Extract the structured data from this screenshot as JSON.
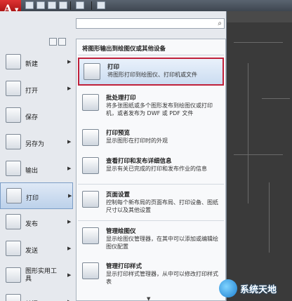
{
  "app": {
    "logo_letter": "A"
  },
  "search": {
    "placeholder": ""
  },
  "left_menu": [
    {
      "label": "新建",
      "icon": "new-file-icon",
      "has_arrow": true
    },
    {
      "label": "打开",
      "icon": "open-folder-icon",
      "has_arrow": true
    },
    {
      "label": "保存",
      "icon": "save-disk-icon",
      "has_arrow": false
    },
    {
      "label": "另存为",
      "icon": "save-as-icon",
      "has_arrow": true
    },
    {
      "label": "输出",
      "icon": "export-icon",
      "has_arrow": true
    },
    {
      "label": "打印",
      "icon": "printer-icon",
      "has_arrow": true,
      "active": true
    },
    {
      "label": "发布",
      "icon": "publish-icon",
      "has_arrow": true
    },
    {
      "label": "发送",
      "icon": "send-icon",
      "has_arrow": true
    },
    {
      "label": "图形实用工具",
      "icon": "drawing-utilities-icon",
      "has_arrow": true,
      "two_line": [
        "图形实用工",
        "具"
      ]
    },
    {
      "label": "关闭",
      "icon": "close-folder-icon",
      "has_arrow": true
    }
  ],
  "submenu": {
    "title": "将图形输出到绘图仪或其他设备",
    "items": [
      {
        "title": "打印",
        "desc": "将图形打印到绘图仪、打印机或文件",
        "icon": "printer-icon",
        "highlighted": true
      },
      {
        "title": "批处理打印",
        "desc": "将多张图纸或多个图形发布到绘图仪或打印机，或者发布为 DWF 或 PDF 文件",
        "icon": "batch-plot-icon"
      },
      {
        "title": "打印预览",
        "desc": "显示图形在打印时的外观",
        "icon": "preview-icon"
      },
      {
        "title": "查看打印和发布详细信息",
        "desc": "显示有关已完成的打印和发布作业的信息",
        "icon": "plot-details-icon"
      },
      {
        "title": "页面设置",
        "desc": "控制每个新布局的页面布局、打印设备、图纸尺寸以及其他设置",
        "icon": "page-setup-icon"
      },
      {
        "title": "管理绘图仪",
        "desc": "显示绘图仪管理器，在其中可以添加或编辑绘图仪配置",
        "icon": "plotter-manager-icon"
      },
      {
        "title": "管理打印样式",
        "desc": "显示打印样式管理器，从中可以修改打印样式表",
        "icon": "plot-styles-icon"
      }
    ]
  },
  "watermark": {
    "text": "系统天地"
  },
  "colors": {
    "highlight_border": "#c0203a",
    "app_button": "#c81e1e",
    "active_item": "#bcd1ea"
  }
}
